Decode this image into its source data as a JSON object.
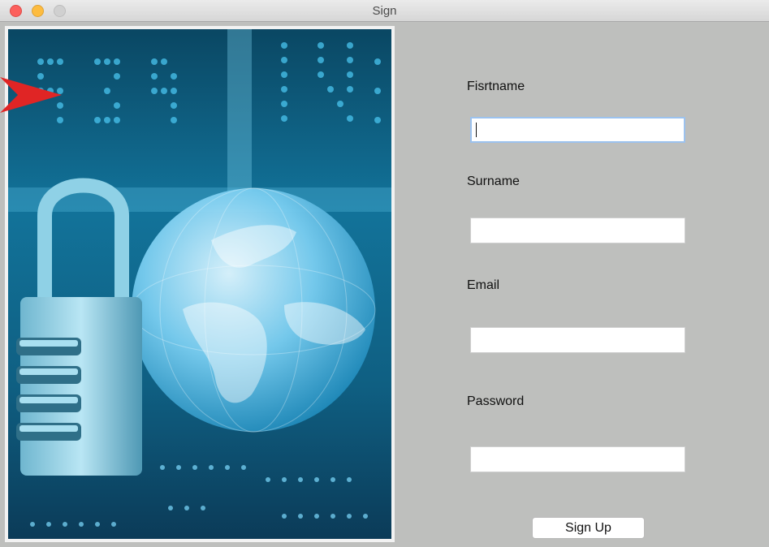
{
  "window": {
    "title": "Sign"
  },
  "form": {
    "firstname_label": "Fisrtname",
    "firstname_value": "",
    "surname_label": "Surname",
    "surname_value": "",
    "email_label": "Email",
    "email_value": "",
    "password_label": "Password",
    "password_value": "",
    "submit_label": "Sign Up"
  },
  "image": {
    "subject": "padlock and glass globe on circuit board"
  },
  "colors": {
    "accent_blue": "#2aa7d6",
    "close": "#fc605c",
    "minimize": "#fdbc40"
  }
}
